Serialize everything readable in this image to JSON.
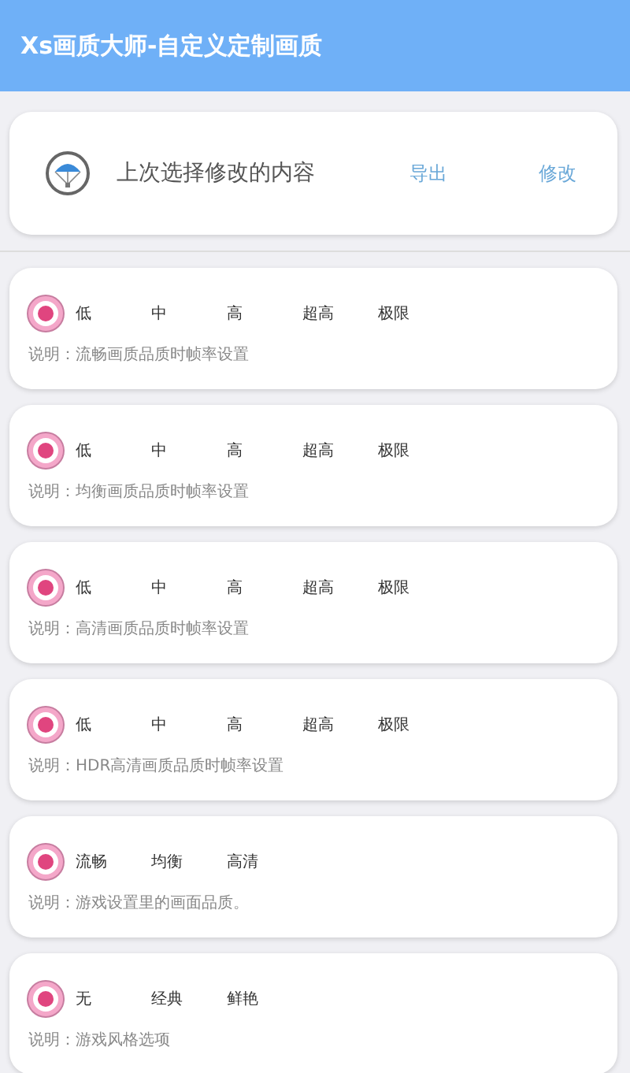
{
  "header": {
    "title": "Xs画质大师-自定义定制画质"
  },
  "summary": {
    "label": "上次选择修改的内容",
    "actions": [
      "导出",
      "修改"
    ]
  },
  "settings": [
    {
      "selected": true,
      "options": [
        "低",
        "中",
        "高",
        "超高",
        "极限"
      ],
      "note": "说明：流畅画质品质时帧率设置"
    },
    {
      "selected": true,
      "options": [
        "低",
        "中",
        "高",
        "超高",
        "极限"
      ],
      "note": "说明：均衡画质品质时帧率设置"
    },
    {
      "selected": true,
      "options": [
        "低",
        "中",
        "高",
        "超高",
        "极限"
      ],
      "note": "说明：高清画质品质时帧率设置"
    },
    {
      "selected": true,
      "options": [
        "低",
        "中",
        "高",
        "超高",
        "极限"
      ],
      "note": "说明：HDR高清画质品质时帧率设置"
    },
    {
      "selected": true,
      "options": [
        "流畅",
        "均衡",
        "高清"
      ],
      "note": "说明：游戏设置里的画面品质。"
    },
    {
      "selected": true,
      "options": [
        "无",
        "经典",
        "鲜艳"
      ],
      "note": "说明：游戏风格选项"
    }
  ]
}
